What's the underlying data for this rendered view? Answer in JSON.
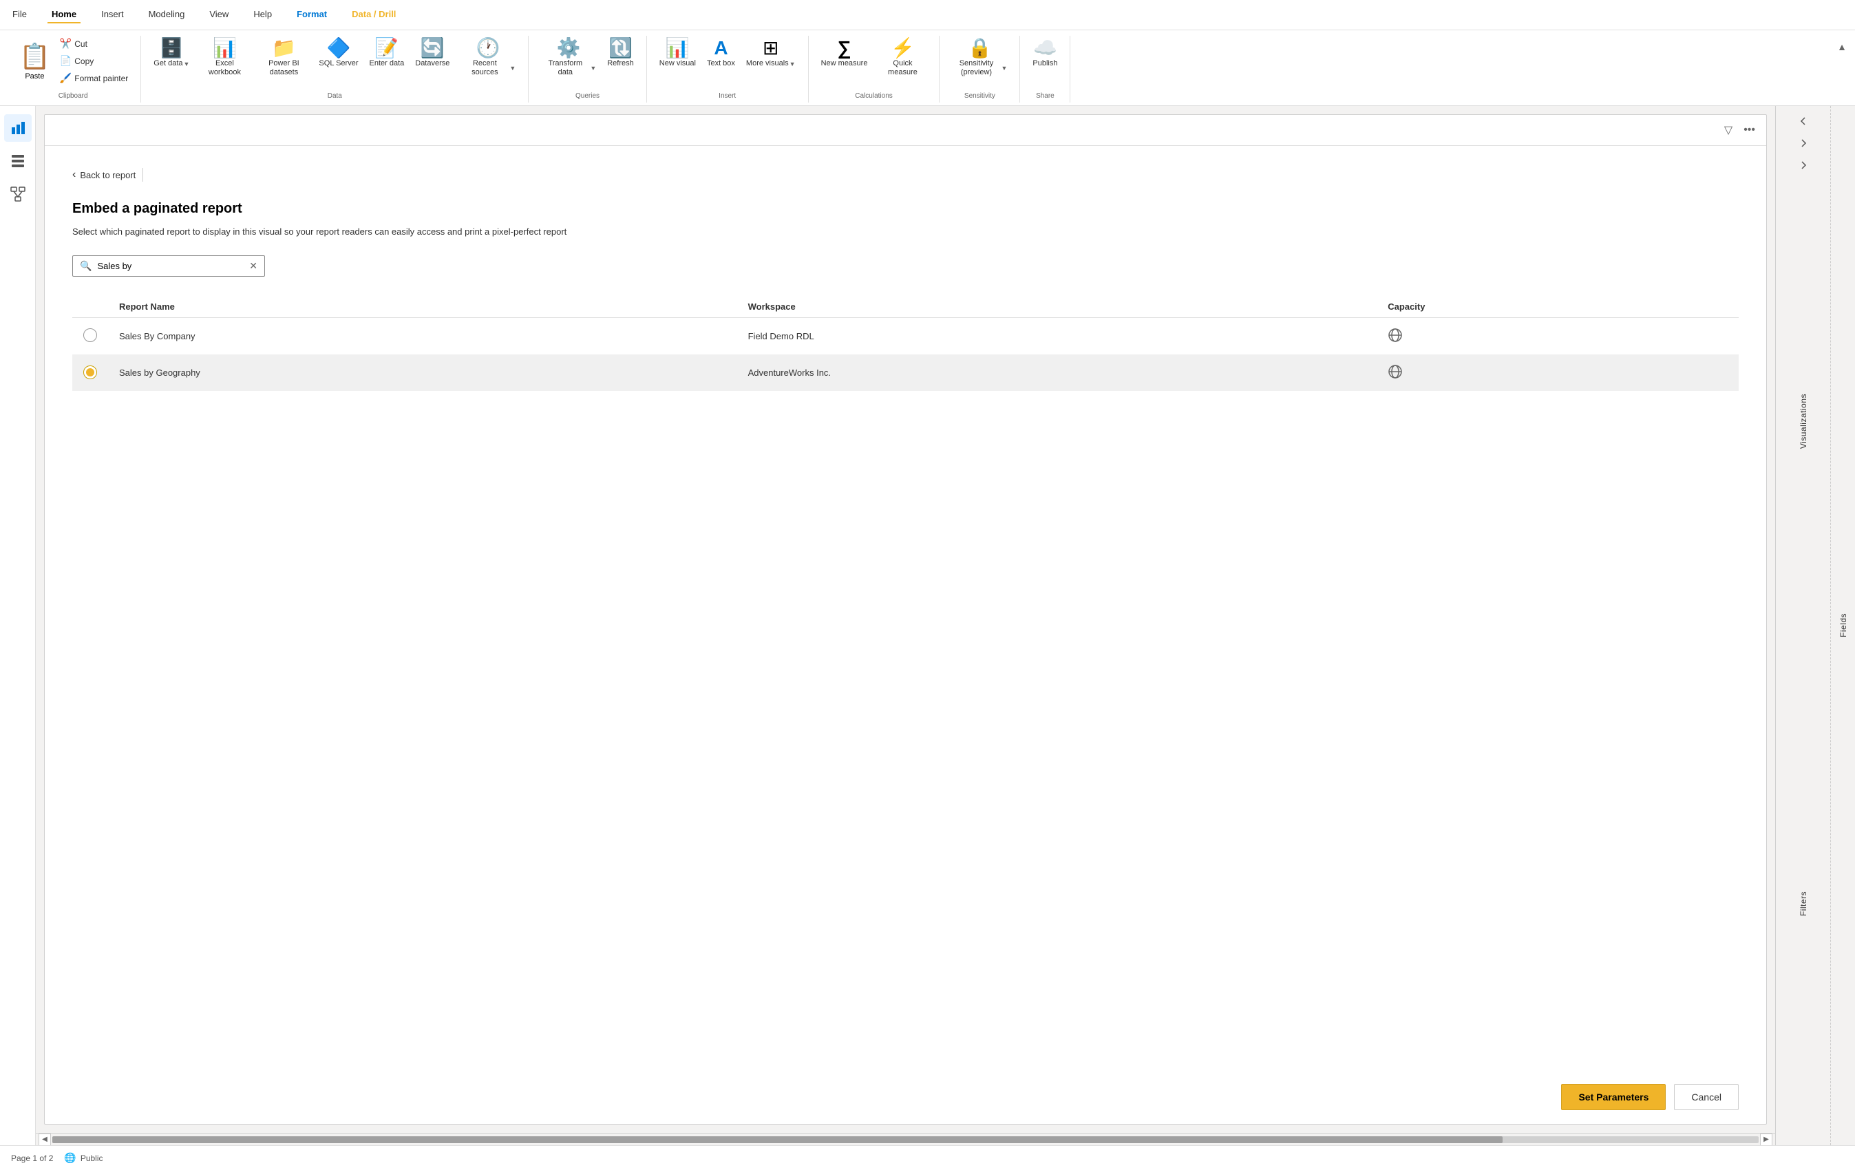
{
  "menubar": {
    "items": [
      {
        "label": "File",
        "active": false
      },
      {
        "label": "Home",
        "active": true
      },
      {
        "label": "Insert",
        "active": false
      },
      {
        "label": "Modeling",
        "active": false
      },
      {
        "label": "View",
        "active": false
      },
      {
        "label": "Help",
        "active": false
      },
      {
        "label": "Format",
        "active": false,
        "style": "format"
      },
      {
        "label": "Data / Drill",
        "active": false,
        "style": "datadrill"
      }
    ]
  },
  "ribbon": {
    "groups": [
      {
        "name": "Clipboard",
        "label": "Clipboard",
        "items": [
          {
            "id": "paste",
            "label": "Paste",
            "icon": "📋",
            "type": "large"
          },
          {
            "id": "cut",
            "label": "Cut",
            "icon": "✂️",
            "type": "small"
          },
          {
            "id": "copy",
            "label": "Copy",
            "icon": "📄",
            "type": "small"
          },
          {
            "id": "format-painter",
            "label": "Format painter",
            "icon": "🖌️",
            "type": "small"
          }
        ]
      },
      {
        "name": "Data",
        "label": "Data",
        "items": [
          {
            "id": "get-data",
            "label": "Get data",
            "icon": "🗄️",
            "dropdown": true
          },
          {
            "id": "excel-workbook",
            "label": "Excel workbook",
            "icon": "📊"
          },
          {
            "id": "power-bi-datasets",
            "label": "Power BI datasets",
            "icon": "📁"
          },
          {
            "id": "sql-server",
            "label": "SQL Server",
            "icon": "🔷"
          },
          {
            "id": "enter-data",
            "label": "Enter data",
            "icon": "📝"
          },
          {
            "id": "dataverse",
            "label": "Dataverse",
            "icon": "🔄"
          },
          {
            "id": "recent-sources",
            "label": "Recent sources",
            "icon": "🕐",
            "dropdown": true
          }
        ]
      },
      {
        "name": "Queries",
        "label": "Queries",
        "items": [
          {
            "id": "transform-data",
            "label": "Transform data",
            "icon": "⚙️",
            "dropdown": true
          },
          {
            "id": "refresh",
            "label": "Refresh",
            "icon": "🔃"
          }
        ]
      },
      {
        "name": "Insert",
        "label": "Insert",
        "items": [
          {
            "id": "new-visual",
            "label": "New visual",
            "icon": "📊"
          },
          {
            "id": "text-box",
            "label": "Text box",
            "icon": "🅣"
          },
          {
            "id": "more-visuals",
            "label": "More visuals",
            "icon": "⊞",
            "dropdown": true
          }
        ]
      },
      {
        "name": "Calculations",
        "label": "Calculations",
        "items": [
          {
            "id": "new-measure",
            "label": "New measure",
            "icon": "∑"
          },
          {
            "id": "quick-measure",
            "label": "Quick measure",
            "icon": "⚡"
          }
        ]
      },
      {
        "name": "Sensitivity",
        "label": "Sensitivity",
        "items": [
          {
            "id": "sensitivity",
            "label": "Sensitivity (preview)",
            "icon": "🔒",
            "dropdown": true
          }
        ]
      },
      {
        "name": "Share",
        "label": "Share",
        "items": [
          {
            "id": "publish",
            "label": "Publish",
            "icon": "☁️"
          }
        ]
      }
    ]
  },
  "dialog": {
    "back_label": "Back to report",
    "title": "Embed a paginated report",
    "description": "Select which paginated report to display in this visual so your report readers can easily access and print a pixel-perfect report",
    "search": {
      "placeholder": "Sales by",
      "value": "Sales by"
    },
    "table": {
      "columns": [
        "Report Name",
        "Workspace",
        "Capacity"
      ],
      "rows": [
        {
          "id": "row1",
          "selected": false,
          "report_name": "Sales By Company",
          "workspace": "Field Demo RDL",
          "capacity": "🌐"
        },
        {
          "id": "row2",
          "selected": true,
          "report_name": "Sales by Geography",
          "workspace": "AdventureWorks Inc.",
          "capacity": "🌐"
        }
      ]
    },
    "buttons": {
      "primary": "Set Parameters",
      "secondary": "Cancel"
    }
  },
  "right_panel": {
    "visualizations_label": "Visualizations",
    "filters_label": "Filters",
    "nav_arrows": [
      "‹",
      "›",
      "‹"
    ]
  },
  "status_bar": {
    "page": "Page 1 of 2",
    "visibility": "Public"
  },
  "sidebar": {
    "icons": [
      {
        "name": "report-view",
        "icon": "📊"
      },
      {
        "name": "data-view",
        "icon": "📋"
      },
      {
        "name": "model-view",
        "icon": "🔗"
      }
    ]
  }
}
